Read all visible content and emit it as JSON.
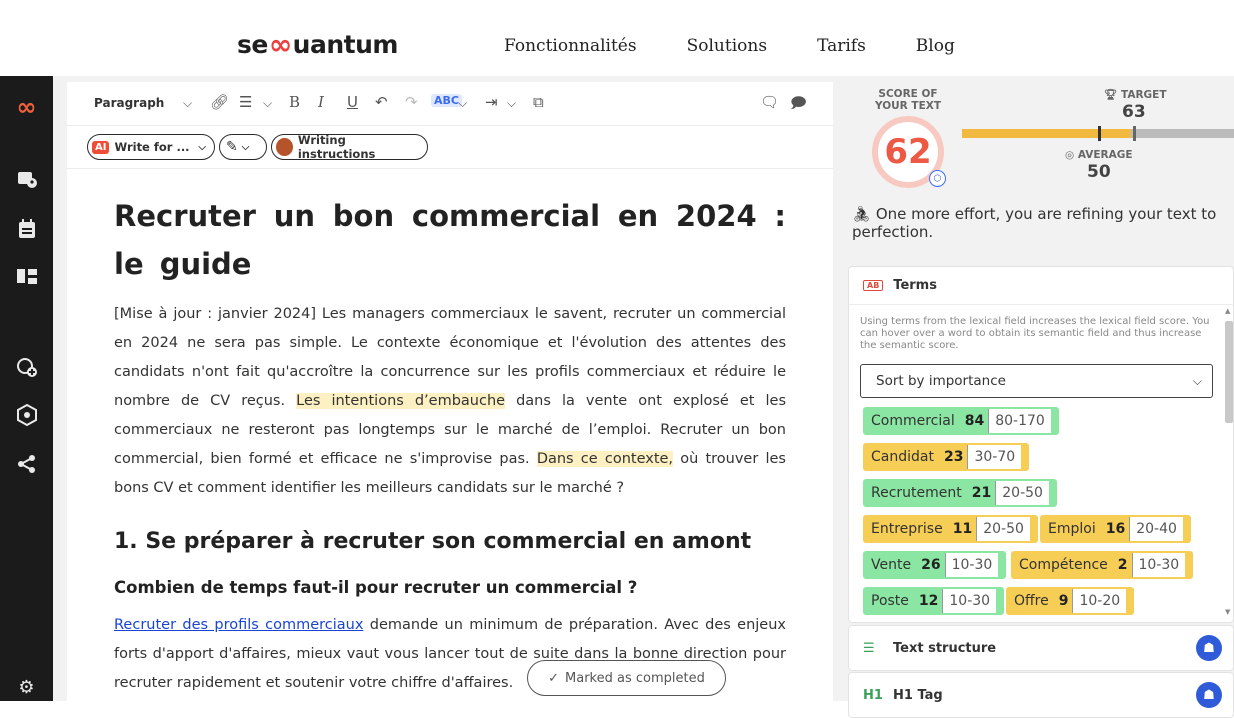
{
  "nav": {
    "logo_left": "se",
    "logo_right": "uantum",
    "links": [
      "Fonctionnalités",
      "Solutions",
      "Tarifs",
      "Blog"
    ]
  },
  "toolbar": {
    "paragraph_label": "Paragraph",
    "write_for_label": "Write for ...",
    "ai_badge": "AI",
    "writing_instructions_label": "Writing instructions",
    "spell_label": "ABC"
  },
  "article": {
    "title": "Recruter un bon commercial en 2024 : le guide",
    "intro_1": "[Mise à jour : janvier 2024] Les managers commerciaux le savent, recruter un commercial en 2024 ne sera pas simple. Le contexte économique et l'évolution des attentes des candidats n'ont fait qu'accroître la concurrence sur les profils commerciaux et réduire le nombre de CV reçus. ",
    "highlight_1": "Les intentions d’embauche",
    "intro_2": " dans la vente ont explosé et les commerciaux ne resteront pas longtemps sur le marché de l’emploi. Recruter un bon commercial, bien formé et efficace ne s'improvise pas. ",
    "highlight_2": "Dans ce contexte,",
    "intro_3": " où trouver les bons CV et comment identifier les meilleurs candidats sur le marché ?",
    "h2": "1. Se préparer à recruter son commercial en amont",
    "h3": "Combien de temps faut-il pour recruter un commercial ?",
    "link_text": "Recruter des profils commerciaux",
    "para2": " demande un minimum de préparation. Avec des enjeux forts d'apport d'affaires, mieux vaut vous lancer tout de suite dans la bonne direction pour recruter rapidement et soutenir votre chiffre d'affaires."
  },
  "completed_label": "Marked as completed",
  "score": {
    "label": "SCORE OF YOUR TEXT",
    "value": "62",
    "target_label": "TARGET",
    "target_value": "63",
    "average_label": "AVERAGE",
    "average_value": "50",
    "bar_fill_fraction": 0.62,
    "effort_text": "One more effort, you are refining your text to perfection."
  },
  "terms": {
    "title": "Terms",
    "help": "Using terms from the lexical field increases the lexical field score. You can hover over a word to obtain its semantic field and thus increase the semantic score.",
    "sort_label": "Sort by importance",
    "items": [
      {
        "term": "Commercial",
        "count": "84",
        "range": "80-170",
        "color": "green"
      },
      {
        "term": "Candidat",
        "count": "23",
        "range": "30-70",
        "color": "yellow"
      },
      {
        "term": "Recrutement",
        "count": "21",
        "range": "20-50",
        "color": "green"
      },
      {
        "term": "Entreprise",
        "count": "11",
        "range": "20-50",
        "color": "yellow"
      },
      {
        "term": "Emploi",
        "count": "16",
        "range": "20-40",
        "color": "yellow"
      },
      {
        "term": "Vente",
        "count": "26",
        "range": "10-30",
        "color": "green"
      },
      {
        "term": "Compétence",
        "count": "2",
        "range": "10-30",
        "color": "yellow"
      },
      {
        "term": "Poste",
        "count": "12",
        "range": "10-30",
        "color": "green"
      },
      {
        "term": "Offre",
        "count": "9",
        "range": "10-20",
        "color": "yellow"
      }
    ]
  },
  "sections": {
    "text_structure": "Text structure",
    "h1_tag": "H1 Tag",
    "h1_lead": "H1"
  },
  "colors": {
    "score_red": "#ec5a46",
    "chip_green": "#8ae6a2",
    "chip_yellow": "#f6cd55",
    "accent_blue": "#2f5bd8"
  }
}
